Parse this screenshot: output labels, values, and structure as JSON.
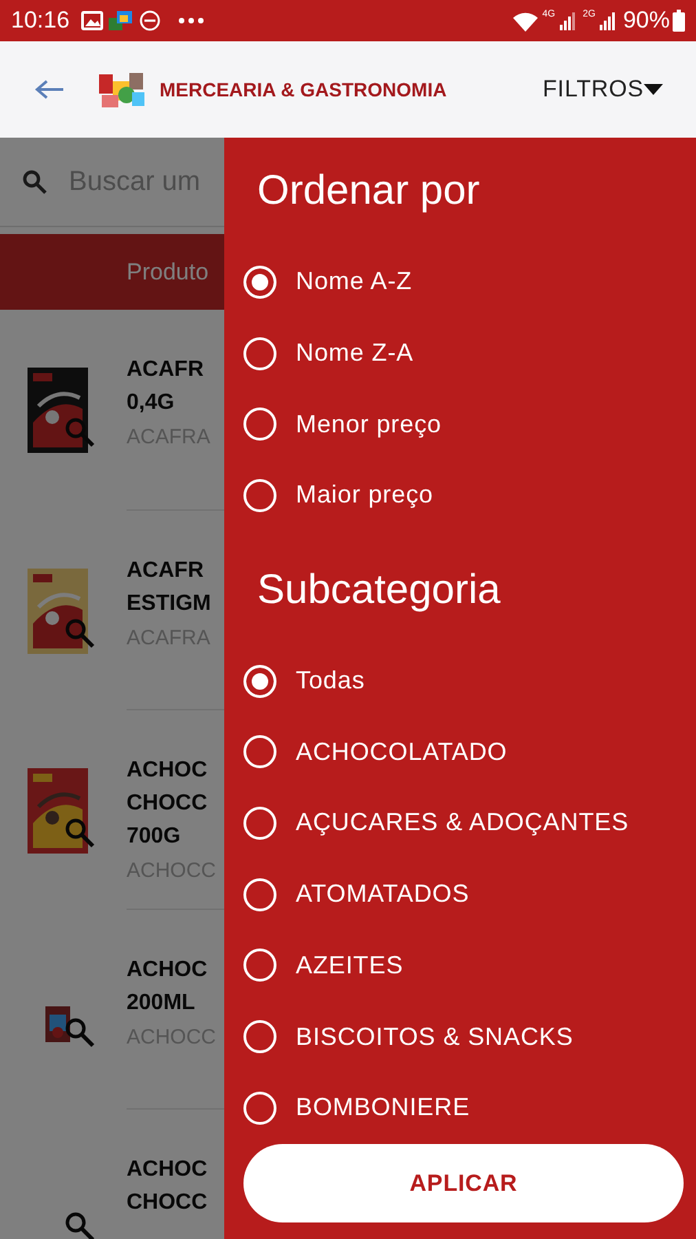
{
  "status_bar": {
    "time": "10:16",
    "network_1": "4G",
    "network_2": "2G",
    "battery": "90%"
  },
  "header": {
    "title": "MERCEARIA & GASTRONOMIA",
    "filter": "FILTROS"
  },
  "search": {
    "placeholder": "Buscar um"
  },
  "tab": {
    "label": "Produto"
  },
  "products": [
    {
      "name": [
        "ACAFR",
        "0,4G"
      ],
      "subtitle": "ACAFRA"
    },
    {
      "name": [
        "ACAFR",
        "ESTIGM"
      ],
      "subtitle": "ACAFRA"
    },
    {
      "name": [
        "ACHOC",
        "CHOCC",
        "700G"
      ],
      "subtitle": "ACHOCC"
    },
    {
      "name": [
        "ACHOC",
        "200ML"
      ],
      "subtitle": "ACHOCC"
    },
    {
      "name": [
        "ACHOC",
        "CHOCC"
      ]
    }
  ],
  "drawer": {
    "sections": [
      {
        "title": "Ordenar por",
        "options": [
          {
            "label": "Nome A-Z",
            "selected": true
          },
          {
            "label": "Nome Z-A",
            "selected": false
          },
          {
            "label": "Menor preço",
            "selected": false
          },
          {
            "label": "Maior preço",
            "selected": false
          }
        ]
      },
      {
        "title": "Subcategoria",
        "options": [
          {
            "label": "Todas",
            "selected": true
          },
          {
            "label": "ACHOCOLATADO",
            "selected": false
          },
          {
            "label": "AÇUCARES & ADOÇANTES",
            "selected": false
          },
          {
            "label": "ATOMATADOS",
            "selected": false
          },
          {
            "label": "AZEITES",
            "selected": false
          },
          {
            "label": "BISCOITOS & SNACKS",
            "selected": false
          },
          {
            "label": "BOMBONIERE",
            "selected": false
          }
        ]
      }
    ],
    "apply_button": "APLICAR"
  }
}
